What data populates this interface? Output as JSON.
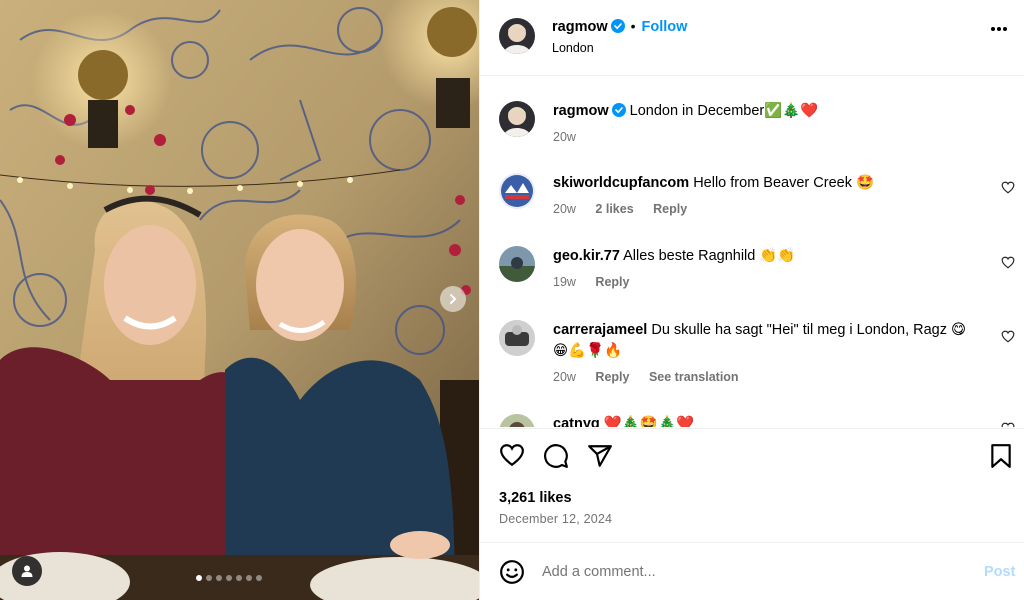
{
  "post": {
    "username": "ragmow",
    "location": "London",
    "follow_label": "Follow",
    "separator": "•",
    "caption": "London in December✅🎄❤️",
    "caption_age": "20w",
    "likes": "3,261 likes",
    "date": "December 12, 2024",
    "carousel": {
      "slide_count": 7,
      "active_index": 0
    }
  },
  "comments": [
    {
      "username": "skiworldcupfancom",
      "text": "Hello from Beaver Creek 🤩",
      "age": "20w",
      "likes": "2 likes",
      "reply": "Reply",
      "extra": ""
    },
    {
      "username": "geo.kir.77",
      "text": "Alles beste Ragnhild 👏👏",
      "age": "19w",
      "likes": "",
      "reply": "Reply",
      "extra": ""
    },
    {
      "username": "carrerajameel",
      "text": "Du skulle ha sagt \"Hei\" til meg i London, Ragz 😋😁💪🌹🔥",
      "age": "20w",
      "likes": "",
      "reply": "Reply",
      "extra": "See translation"
    },
    {
      "username": "catnyg",
      "text": "❤️🎄🤩🎄❤️",
      "age": "",
      "likes": "",
      "reply": "",
      "extra": ""
    }
  ],
  "composer": {
    "placeholder": "Add a comment...",
    "post_label": "Post"
  },
  "icons": {
    "more": "more-options-icon",
    "like": "heart-icon",
    "comment": "comment-icon",
    "share": "share-icon",
    "save": "bookmark-icon",
    "emoji": "emoji-icon",
    "next": "chevron-right-icon",
    "tag": "user-tag-icon"
  },
  "colors": {
    "accent": "#0095f6",
    "muted": "#737373",
    "post_disabled": "#b3dbff"
  }
}
